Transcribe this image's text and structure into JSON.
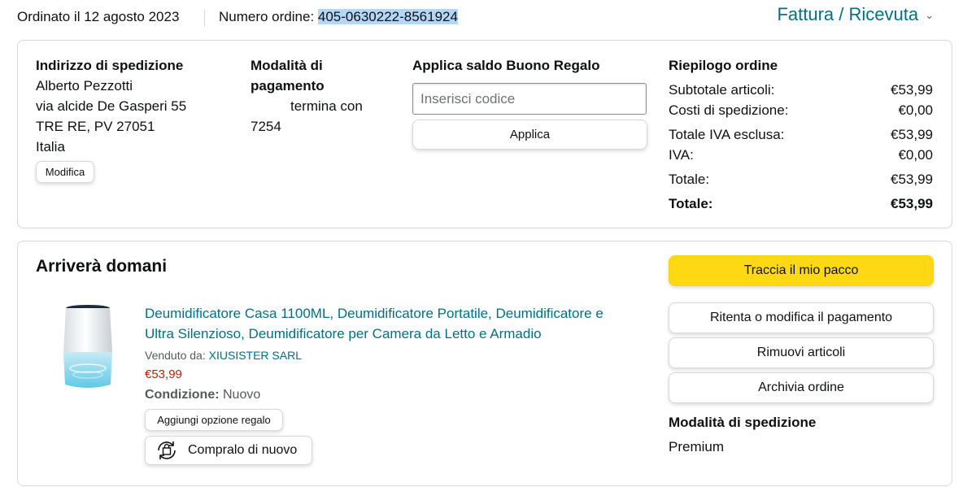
{
  "header": {
    "order_date": "Ordinato il 12 agosto 2023",
    "order_number_label": "Numero ordine: ",
    "order_number": "405-0630222-8561924",
    "invoice_link": "Fattura / Ricevuta",
    "invoice_chevron": "⌄"
  },
  "shipping": {
    "heading": "Indirizzo di spedizione",
    "lines": [
      "Alberto Pezzotti",
      "via alcide De Gasperi 55",
      "TRE RE, PV 27051",
      "Italia"
    ],
    "edit_button": "Modifica"
  },
  "payment": {
    "heading_line1": "Modalità di",
    "heading_line2": "pagamento",
    "card_text": "termina con",
    "card_digits": "7254"
  },
  "gift_card": {
    "heading": "Applica saldo Buono Regalo",
    "placeholder": "Inserisci codice",
    "apply_button": "Applica"
  },
  "summary": {
    "heading": "Riepilogo ordine",
    "rows": [
      {
        "label": "Subtotale articoli:",
        "value": "€53,99"
      },
      {
        "label": "Costi di spedizione:",
        "value": "€0,00"
      },
      {
        "label": "Totale IVA esclusa:",
        "value": "€53,99"
      },
      {
        "label": "IVA:",
        "value": "€0,00"
      },
      {
        "label": "Totale:",
        "value": "€53,99"
      }
    ],
    "grand_total_label": "Totale:",
    "grand_total_value": "€53,99"
  },
  "delivery": {
    "heading": "Arriverà domani",
    "product_title_line1": "Deumidificatore Casa 1100ML, Deumidificatore Portatile, Deumidificatore e",
    "product_title_line2": "Ultra Silenzioso, Deumidificatore per Camera da Letto e Armadio",
    "sold_by_label": "Venduto da: ",
    "seller": "XIUSISTER SARL",
    "price": "€53,99",
    "condition_label": "Condizione:",
    "condition_value": "Nuovo",
    "gift_button": "Aggiungi opzione regalo",
    "buy_again_button": "Compralo di nuovo"
  },
  "actions": {
    "track": "Traccia il mio pacco",
    "retry_payment": "Ritenta o modifica il pagamento",
    "remove_items": "Rimuovi articoli",
    "archive": "Archivia ordine"
  },
  "shipping_method": {
    "heading": "Modalità di spedizione",
    "value": "Premium"
  },
  "colors": {
    "link": "#007185",
    "price": "#b12704",
    "primary_button": "#ffd814",
    "highlight": "#b4d7f7"
  },
  "icons": {
    "buy_again": "rebuy-icon",
    "product": "dehumidifier-image"
  }
}
